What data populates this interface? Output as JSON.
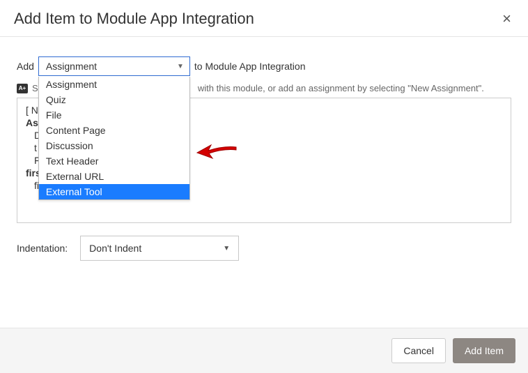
{
  "header": {
    "title": "Add Item to Module App Integration",
    "close": "×"
  },
  "row1": {
    "pre": "Add",
    "post": "to Module App Integration"
  },
  "select": {
    "value": "Assignment",
    "options": [
      "Assignment",
      "Quiz",
      "File",
      "Content Page",
      "Discussion",
      "Text Header",
      "External URL",
      "External Tool"
    ],
    "highlighted": "External Tool"
  },
  "hint": {
    "pre": "Se",
    "post": "with this module, or add an assignment by selecting \"New Assignment\"."
  },
  "list": {
    "l1": "[ N",
    "l2": "As",
    "l3": "D",
    "l4": "t",
    "l5": "F",
    "l6": "firs",
    "l7": "first assignment"
  },
  "indent": {
    "label": "Indentation:",
    "value": "Don't Indent"
  },
  "footer": {
    "cancel": "Cancel",
    "add": "Add Item"
  }
}
